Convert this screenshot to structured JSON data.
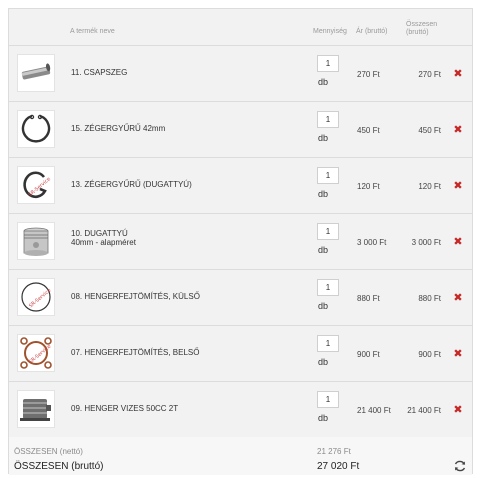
{
  "header": {
    "name_col": "A termék neve",
    "qty_col": "Mennyiség",
    "price_col": "Ár (bruttó)",
    "total_col_line1": "Összesen",
    "total_col_line2": "(bruttó)"
  },
  "items": [
    {
      "name": "11. CSAPSZEG",
      "name2": "",
      "qty": "1",
      "unit": "db",
      "price": "270 Ft",
      "total": "270 Ft",
      "image": "pin-icon"
    },
    {
      "name": "15. ZÉGERGYŰRŰ 42mm",
      "name2": "",
      "qty": "1",
      "unit": "db",
      "price": "450 Ft",
      "total": "450 Ft",
      "image": "circlip-ring-icon"
    },
    {
      "name": "13. ZÉGERGYŰRŰ (DUGATTYÚ)",
      "name2": "",
      "qty": "1",
      "unit": "db",
      "price": "120 Ft",
      "total": "120 Ft",
      "image": "piston-clip-icon"
    },
    {
      "name": "10. DUGATTYÚ",
      "name2": "40mm - alapméret",
      "qty": "1",
      "unit": "db",
      "price": "3 000 Ft",
      "total": "3 000 Ft",
      "image": "piston-icon"
    },
    {
      "name": "08. HENGERFEJTÖMÍTÉS, KÜLSŐ",
      "name2": "",
      "qty": "1",
      "unit": "db",
      "price": "880 Ft",
      "total": "880 Ft",
      "image": "head-gasket-icon"
    },
    {
      "name": "07. HENGERFEJTÖMÍTÉS, BELSŐ",
      "name2": "",
      "qty": "1",
      "unit": "db",
      "price": "900 Ft",
      "total": "900 Ft",
      "image": "inner-gasket-icon"
    },
    {
      "name": "09. HENGER VIZES 50CC 2T",
      "name2": "",
      "qty": "1",
      "unit": "db",
      "price": "21 400 Ft",
      "total": "21 400 Ft",
      "image": "cylinder-icon"
    }
  ],
  "summary": {
    "net_label": "ÖSSZESEN (nettó)",
    "net_value": "21 276 Ft",
    "gross_label": "ÖSSZESEN (bruttó)",
    "gross_value": "27 020 Ft"
  },
  "colors": {
    "delete": "#c62828",
    "background": "#f2f2f2",
    "border": "#dcdcdc"
  }
}
